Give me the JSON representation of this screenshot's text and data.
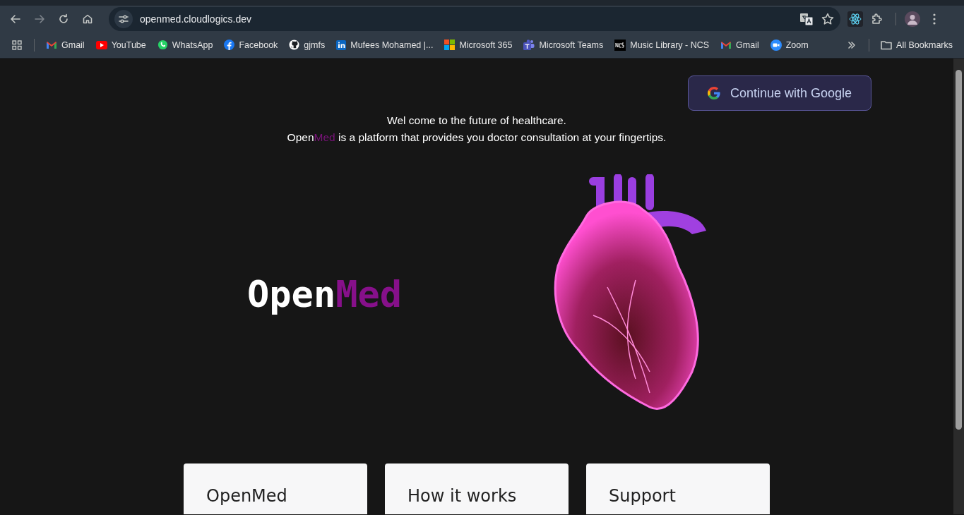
{
  "browser": {
    "url": "openmed.cloudlogics.dev",
    "bookmarks": [
      {
        "kind": "mail",
        "label": "Gmail"
      },
      {
        "kind": "video",
        "label": "YouTube"
      },
      {
        "kind": "chat",
        "label": "WhatsApp"
      },
      {
        "kind": "social",
        "label": "Facebook"
      },
      {
        "kind": "code",
        "label": "gjmfs"
      },
      {
        "kind": "network",
        "label": "Mufees Mohamed |..."
      },
      {
        "kind": "office",
        "label": "Microsoft 365"
      },
      {
        "kind": "team",
        "label": "Microsoft Teams"
      },
      {
        "kind": "music",
        "label": "Music Library - NCS"
      },
      {
        "kind": "mail",
        "label": "Gmail"
      },
      {
        "kind": "meeting",
        "label": "Zoom"
      }
    ],
    "all_bookmarks": "All Bookmarks"
  },
  "page": {
    "login_button": "Continue with Google",
    "welcome": "Wel come to the future of healthcare.",
    "tagline": {
      "brand_first": "Open",
      "brand_accent": "Med",
      "rest": "is a platform that provides you doctor consultation at your fingertips."
    },
    "logo": {
      "first": "Open",
      "accent": "Med"
    },
    "cards": [
      {
        "title": "OpenMed"
      },
      {
        "title": "How it works"
      },
      {
        "title": "Support"
      }
    ]
  }
}
